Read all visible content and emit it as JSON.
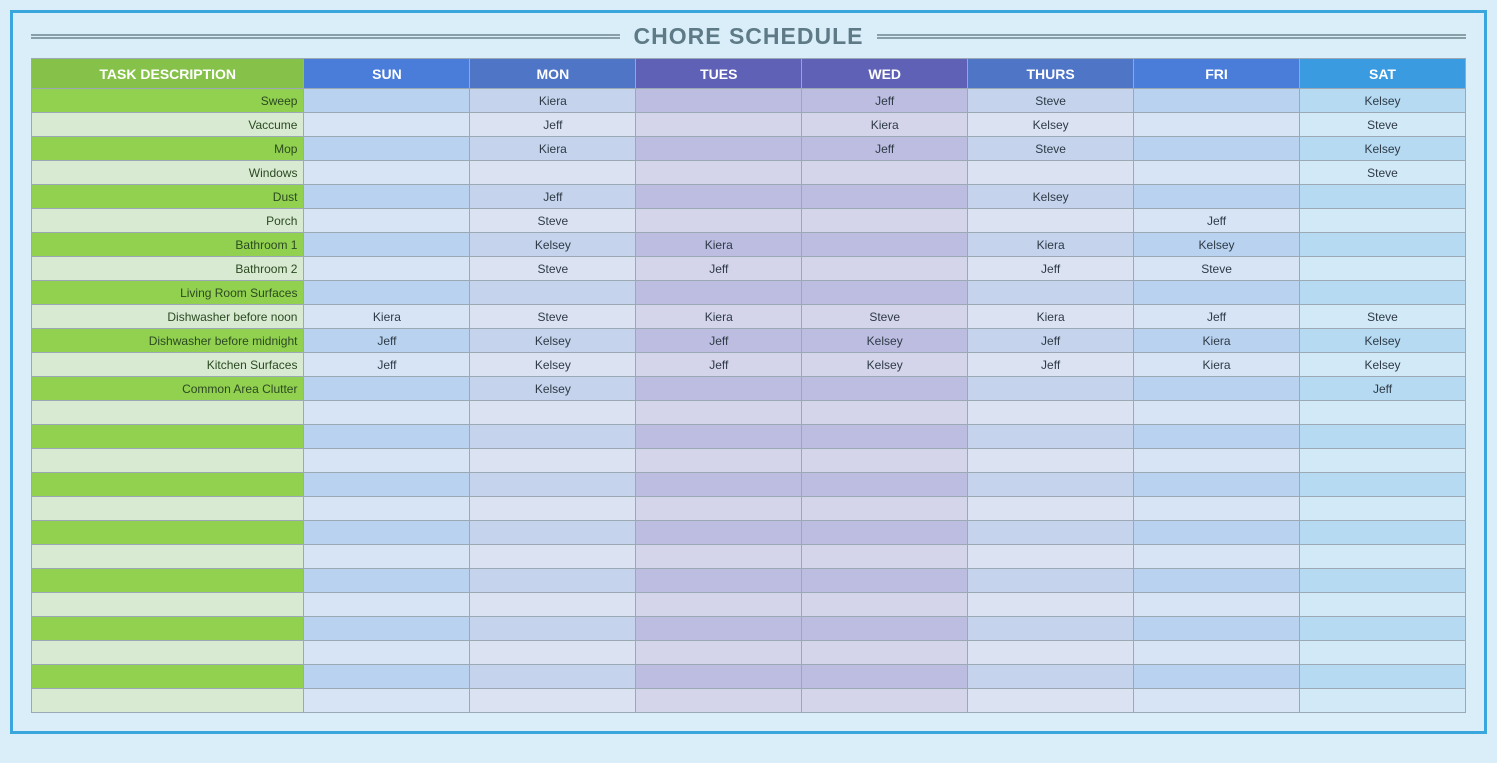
{
  "title": "CHORE SCHEDULE",
  "headers": {
    "task": "TASK DESCRIPTION",
    "days": [
      "SUN",
      "MON",
      "TUES",
      "WED",
      "THURS",
      "FRI",
      "SAT"
    ]
  },
  "rows": [
    {
      "task": "Sweep",
      "days": [
        "",
        "Kiera",
        "",
        "Jeff",
        "Steve",
        "",
        "Kelsey"
      ]
    },
    {
      "task": "Vaccume",
      "days": [
        "",
        "Jeff",
        "",
        "Kiera",
        "Kelsey",
        "",
        "Steve"
      ]
    },
    {
      "task": "Mop",
      "days": [
        "",
        "Kiera",
        "",
        "Jeff",
        "Steve",
        "",
        "Kelsey"
      ]
    },
    {
      "task": "Windows",
      "days": [
        "",
        "",
        "",
        "",
        "",
        "",
        "Steve"
      ]
    },
    {
      "task": "Dust",
      "days": [
        "",
        "Jeff",
        "",
        "",
        "Kelsey",
        "",
        ""
      ]
    },
    {
      "task": "Porch",
      "days": [
        "",
        "Steve",
        "",
        "",
        "",
        "Jeff",
        ""
      ]
    },
    {
      "task": "Bathroom 1",
      "days": [
        "",
        "Kelsey",
        "Kiera",
        "",
        "Kiera",
        "Kelsey",
        ""
      ]
    },
    {
      "task": "Bathroom 2",
      "days": [
        "",
        "Steve",
        "Jeff",
        "",
        "Jeff",
        "Steve",
        ""
      ]
    },
    {
      "task": "Living Room Surfaces",
      "days": [
        "",
        "",
        "",
        "",
        "",
        "",
        ""
      ]
    },
    {
      "task": "Dishwasher before noon",
      "days": [
        "Kiera",
        "Steve",
        "Kiera",
        "Steve",
        "Kiera",
        "Jeff",
        "Steve"
      ]
    },
    {
      "task": "Dishwasher before midnight",
      "days": [
        "Jeff",
        "Kelsey",
        "Jeff",
        "Kelsey",
        "Jeff",
        "Kiera",
        "Kelsey"
      ]
    },
    {
      "task": "Kitchen Surfaces",
      "days": [
        "Jeff",
        "Kelsey",
        "Jeff",
        "Kelsey",
        "Jeff",
        "Kiera",
        "Kelsey"
      ]
    },
    {
      "task": "Common Area Clutter",
      "days": [
        "",
        "Kelsey",
        "",
        "",
        "",
        "",
        "Jeff"
      ]
    },
    {
      "task": "",
      "days": [
        "",
        "",
        "",
        "",
        "",
        "",
        ""
      ]
    },
    {
      "task": "",
      "days": [
        "",
        "",
        "",
        "",
        "",
        "",
        ""
      ]
    },
    {
      "task": "",
      "days": [
        "",
        "",
        "",
        "",
        "",
        "",
        ""
      ]
    },
    {
      "task": "",
      "days": [
        "",
        "",
        "",
        "",
        "",
        "",
        ""
      ]
    },
    {
      "task": "",
      "days": [
        "",
        "",
        "",
        "",
        "",
        "",
        ""
      ]
    },
    {
      "task": "",
      "days": [
        "",
        "",
        "",
        "",
        "",
        "",
        ""
      ]
    },
    {
      "task": "",
      "days": [
        "",
        "",
        "",
        "",
        "",
        "",
        ""
      ]
    },
    {
      "task": "",
      "days": [
        "",
        "",
        "",
        "",
        "",
        "",
        ""
      ]
    },
    {
      "task": "",
      "days": [
        "",
        "",
        "",
        "",
        "",
        "",
        ""
      ]
    },
    {
      "task": "",
      "days": [
        "",
        "",
        "",
        "",
        "",
        "",
        ""
      ]
    },
    {
      "task": "",
      "days": [
        "",
        "",
        "",
        "",
        "",
        "",
        ""
      ]
    },
    {
      "task": "",
      "days": [
        "",
        "",
        "",
        "",
        "",
        "",
        ""
      ]
    },
    {
      "task": "",
      "days": [
        "",
        "",
        "",
        "",
        "",
        "",
        ""
      ]
    }
  ]
}
